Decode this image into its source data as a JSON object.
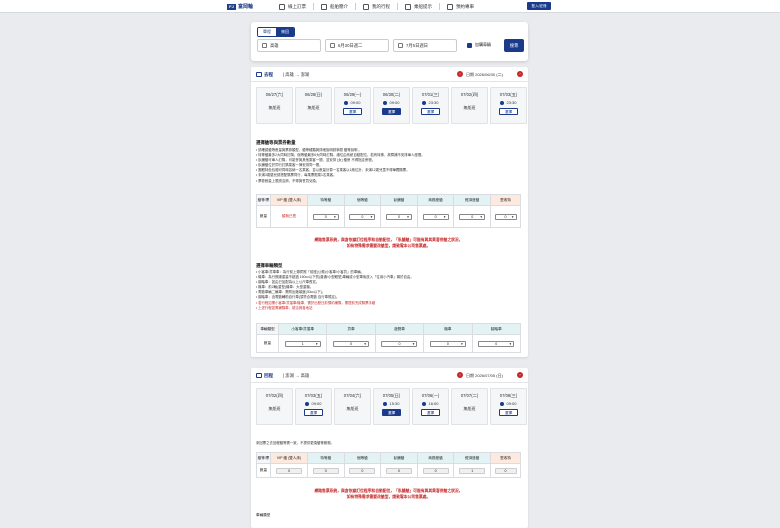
{
  "brand": {
    "mark": "FJ",
    "name": "富岡輪"
  },
  "nav": [
    {
      "label": "線上訂票"
    },
    {
      "label": "船舶簡介"
    },
    {
      "label": "我的行程"
    },
    {
      "label": "乘船提示"
    },
    {
      "label": "預約專車"
    }
  ],
  "header": {
    "login_label": "登入/註冊"
  },
  "search": {
    "tabs": [
      "單程",
      "來回"
    ],
    "active_tab": 1,
    "origin": "高雄",
    "depart_date": "6月30日週二",
    "return_date": "7月5日週日",
    "vehicle_label": "加購車輛",
    "vehicle_checked": true,
    "search_label": "搜尋"
  },
  "outbound": {
    "title": "去程",
    "route": "| 高雄 → 澎湖",
    "date_label": "日期 2026/06/30 (二)",
    "dates": [
      {
        "date": "06/27(六)",
        "status": "無船班"
      },
      {
        "date": "06/28(日)",
        "status": "無船班"
      },
      {
        "date": "06/29(一)",
        "time": "09:00",
        "button": "選擇"
      },
      {
        "date": "06/30(二)",
        "time": "09:00",
        "button": "選擇",
        "selected": true
      },
      {
        "date": "07/01(三)",
        "time": "23:30",
        "button": "選擇"
      },
      {
        "date": "07/02(四)",
        "status": "無船班"
      },
      {
        "date": "07/03(五)",
        "time": "23:30",
        "button": "選擇"
      }
    ],
    "ticket_title": "選擇艙等與票券數量",
    "ticket_notes": [
      "• 請確認艙等數量與票券類型，艙等種類與詳細說明請參閱 艙等說明 。",
      "• 特等艙最多2大同時訂購；個等艙最多6大同時訂購，總位由系統自動配位，若有特殊，故障補不安排單人座間。",
      "• 臥舖艙可單人訂購，可能會與其他乘客一間，並安排 (女) 艙房 不得指定房號。",
      "• 臥舖艙位於同行訂購乘客一律安排同一間。",
      "• 團體特色包廂可同時容納一名乘客，並以數量計算一名乘客以1席位計，未滿12歲兒童不得單獨購票。",
      "• 未滿3歲嬰兒請搭配購票同行，每乘票限乘1名乘客。",
      "• 票券數量上限請洽詢，不得與會員兌換。"
    ],
    "ticket_table": {
      "corner": "艙等/票",
      "columns": [
        {
          "name": "VIP 艙",
          "sub": "(雙人床)"
        },
        {
          "name": "特等艙"
        },
        {
          "name": "個等艙"
        },
        {
          "name": "臥舖艙"
        },
        {
          "name": "商務座艙"
        },
        {
          "name": "經濟座艙"
        },
        {
          "name": "豐收特"
        }
      ],
      "row_label": "數量",
      "vip_text": "暫無已售",
      "values": [
        "0",
        "0",
        "0",
        "0",
        "0",
        "0"
      ]
    },
    "warning": [
      "網路售票系統，與倉依據訂位程序和自動配位，「臥舖艙」可能有與其乘客併艙之狀況，",
      "如有特殊需求需要改艙型，請致電本公司售票處。"
    ],
    "vehicle_title": "選擇車輛類型",
    "vehicle_notes": [
      "• 小客車/貨車車：為行前上傳駕照「前座(公務)小客車/小客貨」的車輛。",
      "• 機車：為行照總重量不超過 150cc以下的(普通/小型輕型)車輛或小型車後放入「往用小汽車」屬於自由。",
      "• 腳踏車：如由已加配為以上公尺車長寬。",
      "• 機車：前2輪(重型)機車：大型重機。",
      "• 電動車輛二輪車：需附出廠碳度(30cc以下)。",
      "• 腳踏車：含電動輔助自行車(須符合電動 自行車規定)。",
      "• 若行程如需小客車/貨運車/機車，需於出發日前預約補購，需提前完成購票手續",
      "• 上述行程如需補購車，請洽詢各地站"
    ],
    "vehicle_table": {
      "corner": "車輛類型",
      "columns": [
        "小客車/貨運車",
        "貨車",
        "遊覽車",
        "機車",
        "腳踏車"
      ],
      "row_label": "數量",
      "values": [
        "1",
        "0",
        "0",
        "0",
        "0"
      ]
    }
  },
  "inbound": {
    "title": "回程",
    "route": "| 澎湖 → 高雄",
    "date_label": "日期 2026/07/05 (日)",
    "dates": [
      {
        "date": "07/02(四)",
        "status": "無船班"
      },
      {
        "date": "07/03(五)",
        "time": "09:00",
        "button": "選擇"
      },
      {
        "date": "07/04(六)",
        "status": "無船班"
      },
      {
        "date": "07/05(日)",
        "time": "15:30",
        "button": "選擇",
        "selected": true
      },
      {
        "date": "07/06(一)",
        "time": "16:00",
        "button": "選擇"
      },
      {
        "date": "07/07(二)",
        "status": "無船班"
      },
      {
        "date": "07/08(三)",
        "time": "09:00",
        "button": "選擇"
      }
    ],
    "note": "來回票之去回程艙等需一致，不提供更換艙等服務。",
    "ticket_table": {
      "corner": "艙等/票",
      "columns": [
        {
          "name": "VIP 艙",
          "sub": "(雙人床)"
        },
        {
          "name": "特等艙"
        },
        {
          "name": "個等艙"
        },
        {
          "name": "臥舖艙"
        },
        {
          "name": "商務座艙"
        },
        {
          "name": "經濟座艙"
        },
        {
          "name": "豐收特"
        }
      ],
      "row_label": "數量",
      "values": [
        "0",
        "0",
        "0",
        "0",
        "0",
        "1",
        "0"
      ]
    },
    "warning": [
      "網路售票系統，與倉依據訂位程序和自動配位，「臥舖艙」可能有與其乘客併艙之狀況，",
      "如有特殊需求需要改艙型，請致電本公司售票處。"
    ],
    "vehicle_title": "車輛類型"
  }
}
